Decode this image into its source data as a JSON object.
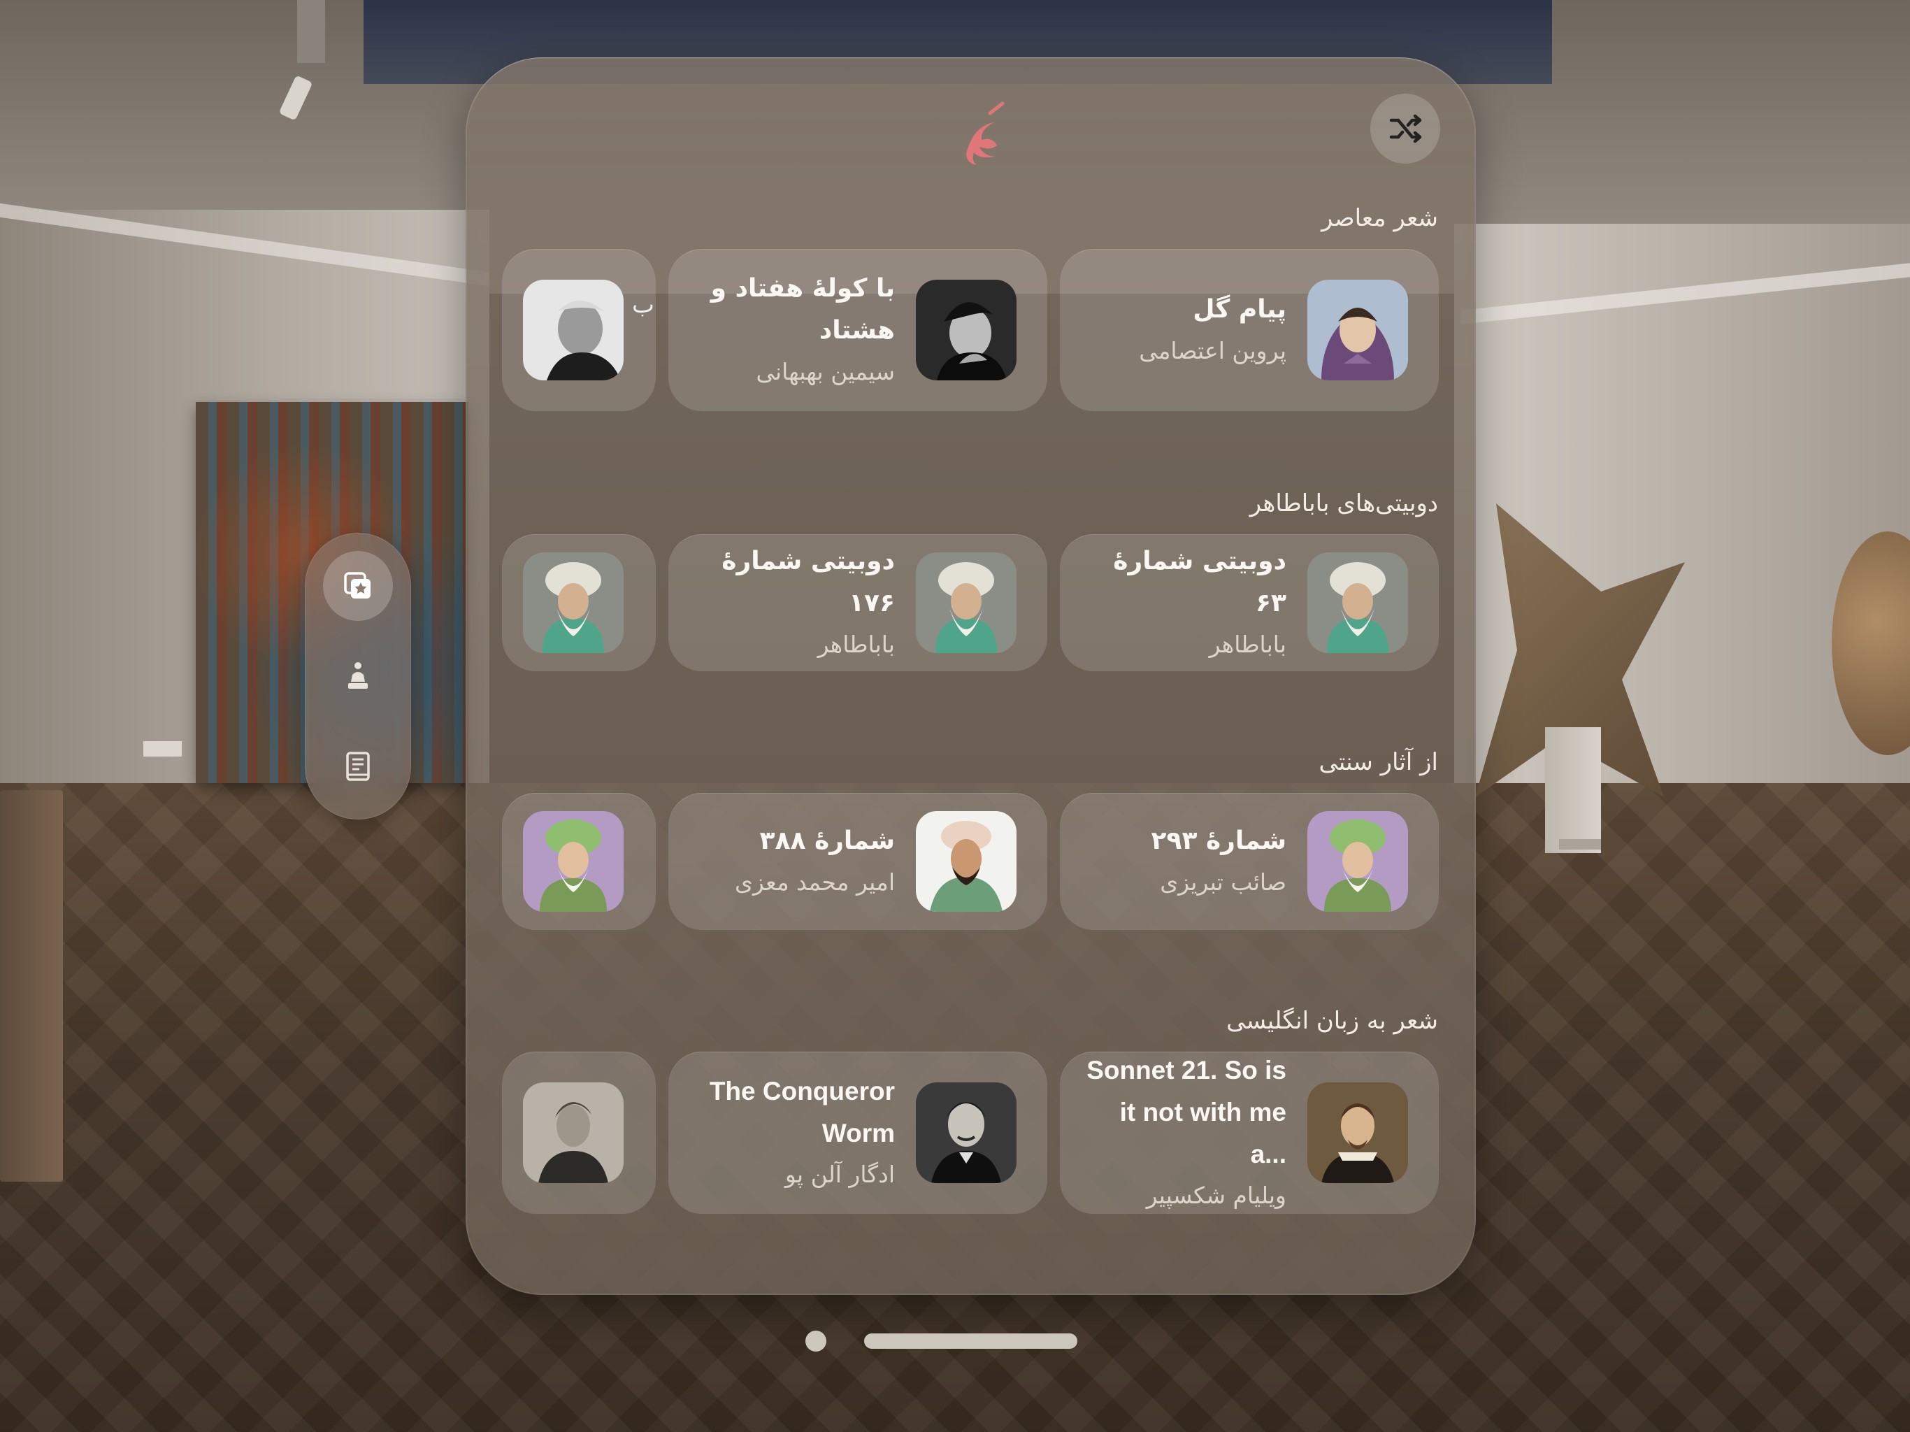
{
  "app": {
    "logo_alt": "logo-calligraphy",
    "accent_color": "#e0767a"
  },
  "toolbar": {
    "shuffle_icon": "shuffle-icon"
  },
  "tabs": [
    {
      "icon": "favorites-icon",
      "active": true
    },
    {
      "icon": "poet-icon",
      "active": false
    },
    {
      "icon": "book-icon",
      "active": false
    }
  ],
  "sections": [
    {
      "title": "شعر معاصر",
      "cards": [
        {
          "title": "پیام گل",
          "subtitle": "پروین اعتصامی",
          "avatar": "portrait-woman-headscarf"
        },
        {
          "title": "با کولهٔ هفتاد و هشتاد",
          "subtitle": "سیمین بهبهانی",
          "avatar": "portrait-woman-bw"
        },
        {
          "title": "",
          "subtitle": "",
          "avatar": "portrait-man-bw"
        }
      ]
    },
    {
      "title": "دوبیتی‌های باباطاهر",
      "cards": [
        {
          "title": "دوبیتی شمارهٔ ۶۳",
          "subtitle": "باباطاهر",
          "avatar": "portrait-turban-sage"
        },
        {
          "title": "دوبیتی شمارهٔ ۱۷۶",
          "subtitle": "باباطاهر",
          "avatar": "portrait-turban-sage"
        },
        {
          "title": "",
          "subtitle": "",
          "avatar": "portrait-turban-sage"
        }
      ]
    },
    {
      "title": "از آثار سنتی",
      "cards": [
        {
          "title": "شمارهٔ ۲۹۳",
          "subtitle": "صائب تبریزی",
          "avatar": "portrait-green-turban"
        },
        {
          "title": "شمارهٔ ۳۸۸",
          "subtitle": "امیر محمد معزی",
          "avatar": "portrait-painted-man"
        },
        {
          "title": "",
          "subtitle": "",
          "avatar": "portrait-green-turban"
        }
      ]
    },
    {
      "title": "شعر به زبان انگلیسی",
      "cards": [
        {
          "title": "Sonnet 21. So is it not with me a...",
          "subtitle": "ویلیام شکسپیر",
          "avatar": "portrait-shakespeare"
        },
        {
          "title": "The Conqueror Worm",
          "subtitle": "ادگار آلن پو",
          "avatar": "portrait-poe"
        },
        {
          "title": "",
          "subtitle": "",
          "avatar": "portrait-yeats"
        }
      ]
    }
  ]
}
